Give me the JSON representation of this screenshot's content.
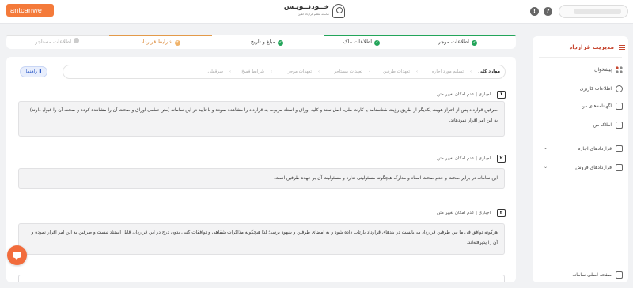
{
  "header": {
    "brand_badge": "antcanwe",
    "logo_title": "خــودنــویـس",
    "logo_subtitle": "سامانه تنظیم قرارداد آنلاین",
    "help_icon_label": "?",
    "alert_icon_label": "!"
  },
  "stepper": {
    "steps": [
      {
        "label": "اطلاعات موجر",
        "state": "done"
      },
      {
        "label": "اطلاعات ملک",
        "state": "done"
      },
      {
        "label": "مبلغ و تاریخ",
        "state": "done"
      },
      {
        "label": "شرایط قرارداد",
        "state": "active",
        "number": "۴"
      },
      {
        "label": "اطلاعات مستاجر",
        "state": "todo"
      }
    ]
  },
  "content": {
    "guide_button": "راهنما",
    "tabs": [
      {
        "label": "موارد کلی",
        "active": true
      },
      {
        "label": "تسلیم مورد اجاره",
        "active": false
      },
      {
        "label": "تعهدات طرفین",
        "active": false
      },
      {
        "label": "تعهدات مستاجر",
        "active": false
      },
      {
        "label": "تعهدات موجر",
        "active": false
      },
      {
        "label": "شرایط فسخ",
        "active": false
      },
      {
        "label": "سرقفلی",
        "active": false
      }
    ],
    "clauses": [
      {
        "number": "۱",
        "tag": "اجباری  |  عدم امکان تغییر متن",
        "text": "طرفین قرارداد پس از احراز هویت یکدیگر از طریق رؤیت شناسنامه یا کارت ملی، اصل سند و کلیه اوراق و اسناد مربوط به قرارداد را مشاهده نموده و با تأیید در این سامانه (متن تمامی اوراق و صحت آن را مشاهده کرده و صحت آن را قبول دارند) به این امر اقرار نمودهاند."
      },
      {
        "number": "۲",
        "tag": "اجباری  |  عدم امکان تغییر متن",
        "text": "این سامانه در برابر صحت و عدم صحت اسناد و مدارک هیچگونه مسئولیتی ندارد و مسئولیت آن بر عهده طرفین است."
      },
      {
        "number": "۳",
        "tag": "اجباری  |  عدم امکان تغییر متن",
        "text": "هرگونه توافق فی ما بین طرفین قرارداد می‌بایست در بندهای قرارداد بازتاب داده شود و به امضای طرفین و شهود برسد؛ لذا هیچگونه مذاکرات شفاهی و توافقات کتبی بدون درج در این قرارداد، قابل استناد نیست و طرفین به این امر اقرار نموده و آن را پذیرفته‌اند."
      }
    ]
  },
  "sidebar": {
    "title": "مدیریت قرارداد",
    "items": [
      {
        "label": "پیشخوان",
        "icon": "dashboard-grid-icon"
      },
      {
        "label": "اطلاعات کاربری",
        "icon": "user-icon"
      },
      {
        "label": "آگهینامه‌های من",
        "icon": "document-icon"
      },
      {
        "label": "املاک من",
        "icon": "building-icon"
      },
      {
        "label": "قراردادهای اجاره",
        "icon": "contract-icon",
        "expandable": true
      },
      {
        "label": "قراردادهای فروش",
        "icon": "contract-icon",
        "expandable": true
      },
      {
        "label": "صفحه اصلی سامانه",
        "icon": "home-icon"
      }
    ]
  },
  "colors": {
    "accent": "#c7462f",
    "done_green": "#23a55a",
    "active_orange": "#d9822b",
    "brand_orange": "#f47a3a",
    "chat_button": "#f26c3c"
  }
}
